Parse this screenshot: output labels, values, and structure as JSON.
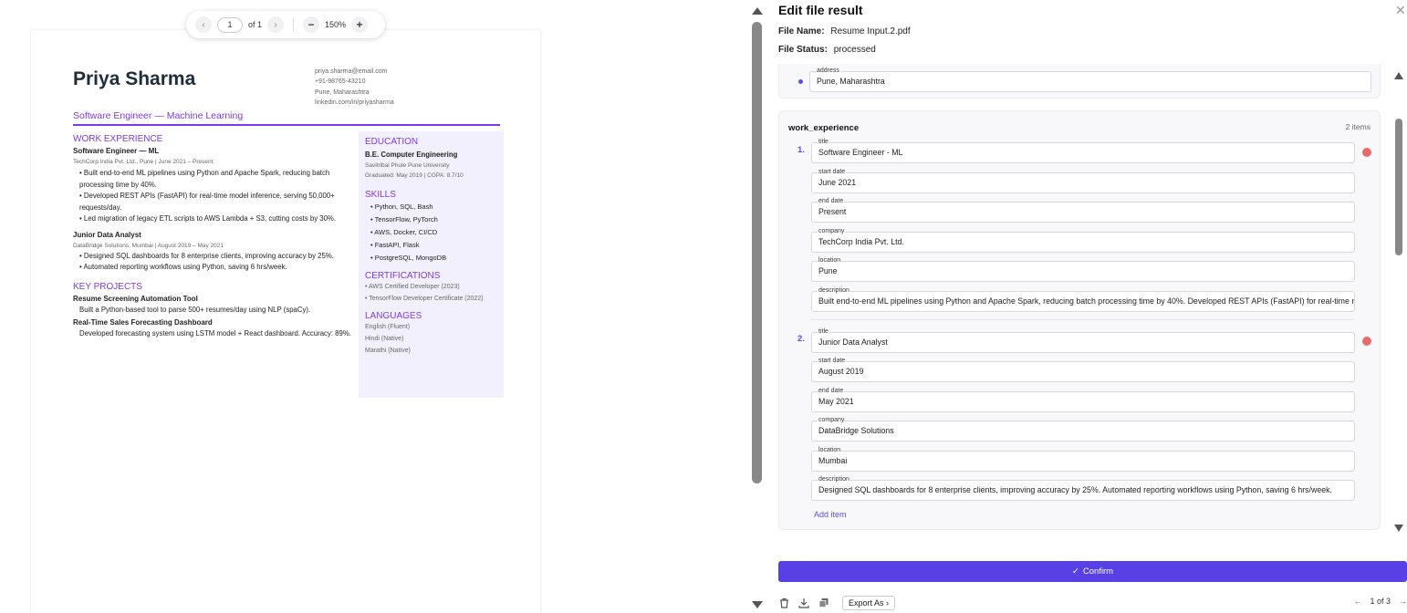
{
  "viewer": {
    "toolbar": {
      "prev_icon": "chevron-left-icon",
      "page_value": "1",
      "page_of": "of 1",
      "next_icon": "chevron-right-icon",
      "zoom_out": "−",
      "zoom_level": "150%",
      "zoom_in": "+"
    },
    "resume": {
      "name": "Priya Sharma",
      "contact": [
        "priya.sharma@email.com",
        "+91-98765-43210",
        "Pune, Maharashtra",
        "linkedin.com/in/priyasharma"
      ],
      "subtitle": "Software Engineer — Machine Learning",
      "work_heading": "WORK EXPERIENCE",
      "jobs": [
        {
          "title": "Software Engineer — ML",
          "meta": "TechCorp India Pvt. Ltd., Pune | June 2021 – Present",
          "bullets": [
            "• Built end-to-end ML pipelines using Python and Apache Spark, reducing batch processing time by 40%.",
            "• Developed REST APIs (FastAPI) for real-time model inference, serving 50,000+ requests/day.",
            "• Led migration of legacy ETL scripts to AWS Lambda + S3, cutting costs by 30%."
          ]
        },
        {
          "title": "Junior Data Analyst",
          "meta": "DataBridge Solutions, Mumbai | August 2019 – May 2021",
          "bullets": [
            "• Designed SQL dashboards for 8 enterprise clients, improving accuracy by 25%.",
            "• Automated reporting workflows using Python, saving 6 hrs/week."
          ]
        }
      ],
      "projects_heading": "KEY PROJECTS",
      "projects": [
        {
          "title": "Resume Screening Automation Tool",
          "desc": "Built a Python-based tool to parse 500+ resumes/day using NLP (spaCy)."
        },
        {
          "title": "Real-Time Sales Forecasting Dashboard",
          "desc": "Developed forecasting system using LSTM model + React dashboard. Accuracy: 89%."
        }
      ],
      "education_heading": "EDUCATION",
      "degree": "B.E. Computer Engineering",
      "university": "Savitribai Phule Pune University",
      "graduated": "Graduated: May 2019 | CGPA: 8.7/10",
      "skills_heading": "SKILLS",
      "skills": [
        "• Python, SQL, Bash",
        "• TensorFlow, PyTorch",
        "• AWS, Docker, CI/CD",
        "• FastAPI, Flask",
        "• PostgreSQL, MongoDB"
      ],
      "cert_heading": "CERTIFICATIONS",
      "certs": [
        "• AWS Certified Developer (2023)",
        "• TensorFlow Developer Certificate (2022)"
      ],
      "lang_heading": "LANGUAGES",
      "languages": [
        "English (Fluent)",
        "Hindi (Native)",
        "Marathi (Native)"
      ]
    }
  },
  "editor": {
    "title": "Edit file result",
    "close_icon": "close-icon",
    "file_name_label": "File Name:",
    "file_name": "Resume Input.2.pdf",
    "file_status_label": "File Status:",
    "file_status": "processed",
    "address": {
      "label": "address",
      "value": "Pune, Maharashtra"
    },
    "work_experience": {
      "label": "work_experience",
      "count": "2 items",
      "items": [
        {
          "index": "1.",
          "title_label": "title",
          "title": "Software Engineer - ML",
          "start_label": "start date",
          "start": "June 2021",
          "end_label": "end date",
          "end": "Present",
          "company_label": "company",
          "company": "TechCorp India Pvt. Ltd.",
          "location_label": "location",
          "location": "Pune",
          "desc_label": "description",
          "desc": "Built end-to-end ML pipelines using Python and Apache Spark, reducing batch processing time by 40%. Developed REST APIs (FastAPI) for real-time model inference"
        },
        {
          "index": "2.",
          "title_label": "title",
          "title": "Junior Data Analyst",
          "start_label": "start date",
          "start": "August 2019",
          "end_label": "end date",
          "end": "May 2021",
          "company_label": "company",
          "company": "DataBridge Solutions",
          "location_label": "location",
          "location": "Mumbai",
          "desc_label": "description",
          "desc": "Designed SQL dashboards for 8 enterprise clients, improving accuracy by 25%. Automated reporting workflows using Python, saving 6 hrs/week."
        }
      ],
      "add_item": "Add item"
    },
    "confirm": "Confirm",
    "confirm_icon": "check-icon",
    "bottom": {
      "delete_icon": "trash-icon",
      "download_icon": "download-icon",
      "copy_icon": "copy-icon",
      "export_label": "Export As",
      "pager": "1 of 3"
    },
    "colors": {
      "accent": "#5640e6",
      "resume_accent": "#7c3aed",
      "remove": "#e66c6c"
    }
  }
}
